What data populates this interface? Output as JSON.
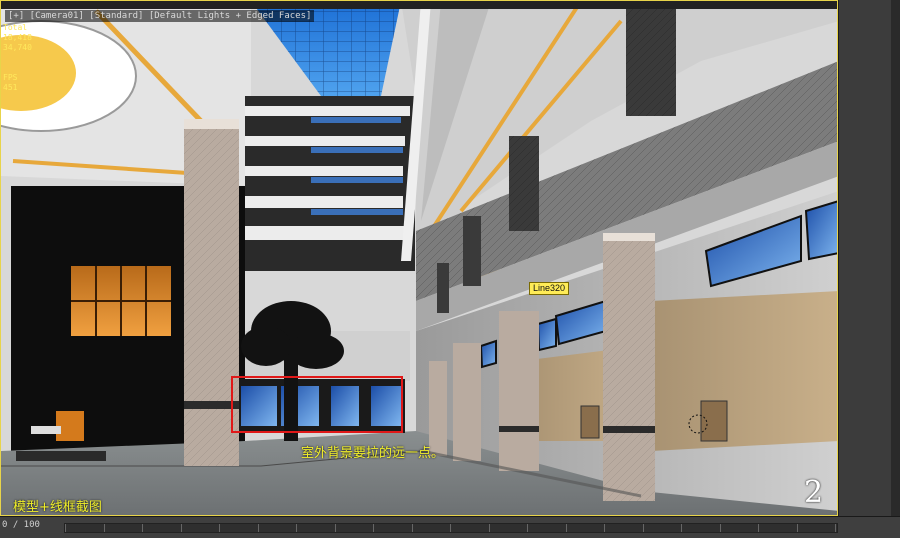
{
  "viewport": {
    "label": "[+] [Camera01] [Standard] [Default Lights + Edged Faces]",
    "stats": [
      "Total",
      "18,418",
      "34,740",
      "",
      "FPS",
      "451"
    ],
    "object_label": "Line320",
    "annotation_note": "室外背景要拉的远一点。",
    "caption": "模型+线框截图",
    "number": "2"
  },
  "timeline": {
    "frame_label": "0 / 100"
  },
  "colors": {
    "annotation_text": "#f1ef2a",
    "highlight_box": "#e01818",
    "viewport_border": "#e8d44a"
  }
}
